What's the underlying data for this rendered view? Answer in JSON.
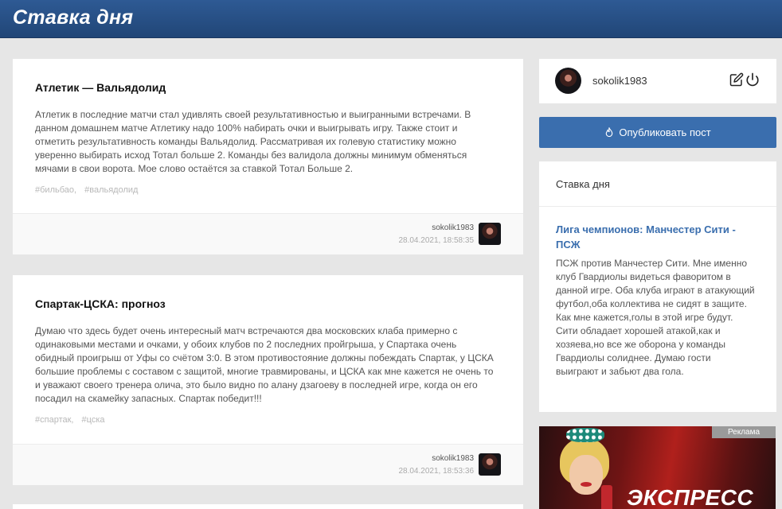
{
  "header": {
    "title": "Ставка дня"
  },
  "posts": [
    {
      "title": "Атлетик — Вальядолид",
      "text": "Атлетик в последние матчи стал удивлять своей результативностью и выигранными встречами. В данном домашнем матче Атлетику надо 100% набирать очки и выигрывать игру. Также стоит и отметить результативность команды Вальядолид. Рассматривая их голевую статистику можно уверенно выбирать исход Тотал больше 2. Команды без валидола должны минимум обменяться мячами в свои ворота. Мое слово остаётся за ставкой Тотал Больше 2.",
      "tags": [
        "#бильбао,",
        "#вальядолид"
      ],
      "author": "sokolik1983",
      "date": "28.04.2021, 18:58:35"
    },
    {
      "title": "Спартак-ЦСКА: прогноз",
      "text": "Думаю что здесь будет очень интересный матч встречаются два московских клаба примерно с одинаковыми местами и очками, у обоих клубов по 2 последних пройгрыша, у Спартака очень обидный проигрыш от Уфы со счётом 3:0. В этом противостояние должны побеждать Спартак, у ЦСКА большие проблемы с составом с защитой, многие травмированы, и ЦСКА как мне кажется не очень то и уважают своего тренера олича, это было видно по алану дзагоеву в последней игре, когда он его посадил на скамейку запасных. Спартак победит!!!",
      "tags": [
        "#спартак,",
        "#цска"
      ],
      "author": "sokolik1983",
      "date": "28.04.2021, 18:53:36"
    }
  ],
  "sidebar": {
    "user": {
      "name": "sokolik1983"
    },
    "publish_label": "Опубликовать пост",
    "day": {
      "heading": "Ставка дня",
      "title": "Лига чемпионов: Манчестер Сити - ПСЖ",
      "text": "ПСЖ против Манчестер Сити. Мне именно клуб Гвардиолы видеться фаворитом в данной игре. Оба клуба играют в атакующий футбол,оба коллектива не сидят в защите. Как мне кажется,голы в этой игре будут. Сити обладает хорошей атакой,как и хозяева,но все же оборона у команды Гвардиолы солиднее. Думаю гости выиграют и забьют два гола."
    },
    "ad": {
      "label": "Реклама",
      "text": "ЭКСПРЕСС"
    }
  },
  "colors": {
    "header": "#214677",
    "accent": "#3a6eae"
  },
  "icons": [
    "edit-icon",
    "power-icon",
    "fire-icon"
  ]
}
